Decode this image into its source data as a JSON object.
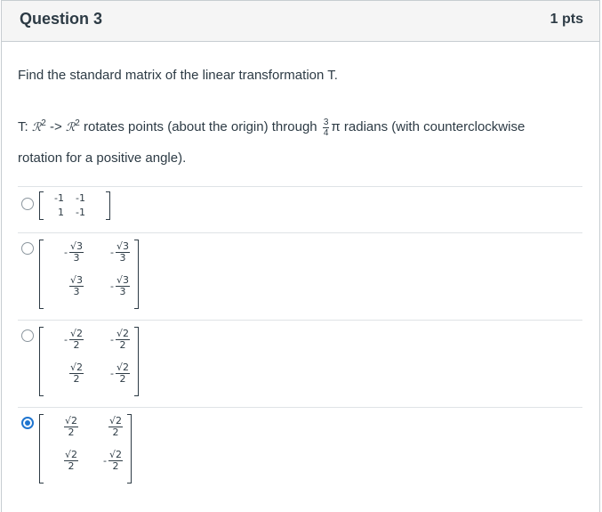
{
  "question": {
    "title": "Question 3",
    "points": "1 pts",
    "prompt": "Find the standard matrix of the linear transformation T.",
    "desc": {
      "t_prefix": "T: ",
      "space_symbol": "ℛ",
      "exponent": "2",
      "arrow": " -> ",
      "mid_text": " rotates points (about the origin) through ",
      "angle_num": "3",
      "angle_den": "4",
      "pi": "π",
      "tail_text": " radians (with counterclockwise",
      "line2": "rotation for a positive angle)."
    }
  },
  "options": [
    {
      "selected": false,
      "cells": [
        {
          "neg": "",
          "text": "-1"
        },
        {
          "neg": "",
          "text": "-1"
        },
        {
          "neg": "",
          "text": "1"
        },
        {
          "neg": "",
          "text": "-1"
        }
      ]
    },
    {
      "selected": false,
      "cells": [
        {
          "neg": "-",
          "num": "√3",
          "den": "3"
        },
        {
          "neg": "-",
          "num": "√3",
          "den": "3"
        },
        {
          "neg": "",
          "num": "√3",
          "den": "3"
        },
        {
          "neg": "-",
          "num": "√3",
          "den": "3"
        }
      ]
    },
    {
      "selected": false,
      "cells": [
        {
          "neg": "-",
          "num": "√2",
          "den": "2"
        },
        {
          "neg": "-",
          "num": "√2",
          "den": "2"
        },
        {
          "neg": "",
          "num": "√2",
          "den": "2"
        },
        {
          "neg": "-",
          "num": "√2",
          "den": "2"
        }
      ]
    },
    {
      "selected": true,
      "cells": [
        {
          "neg": "",
          "num": "√2",
          "den": "2"
        },
        {
          "neg": "",
          "num": "√2",
          "den": "2"
        },
        {
          "neg": "",
          "num": "√2",
          "den": "2"
        },
        {
          "neg": "-",
          "num": "√2",
          "den": "2"
        }
      ]
    }
  ],
  "colors": {
    "accent": "#1f75d0",
    "text": "#2d3b45",
    "header_bg": "#f5f5f5",
    "border": "#c7cdd1"
  }
}
